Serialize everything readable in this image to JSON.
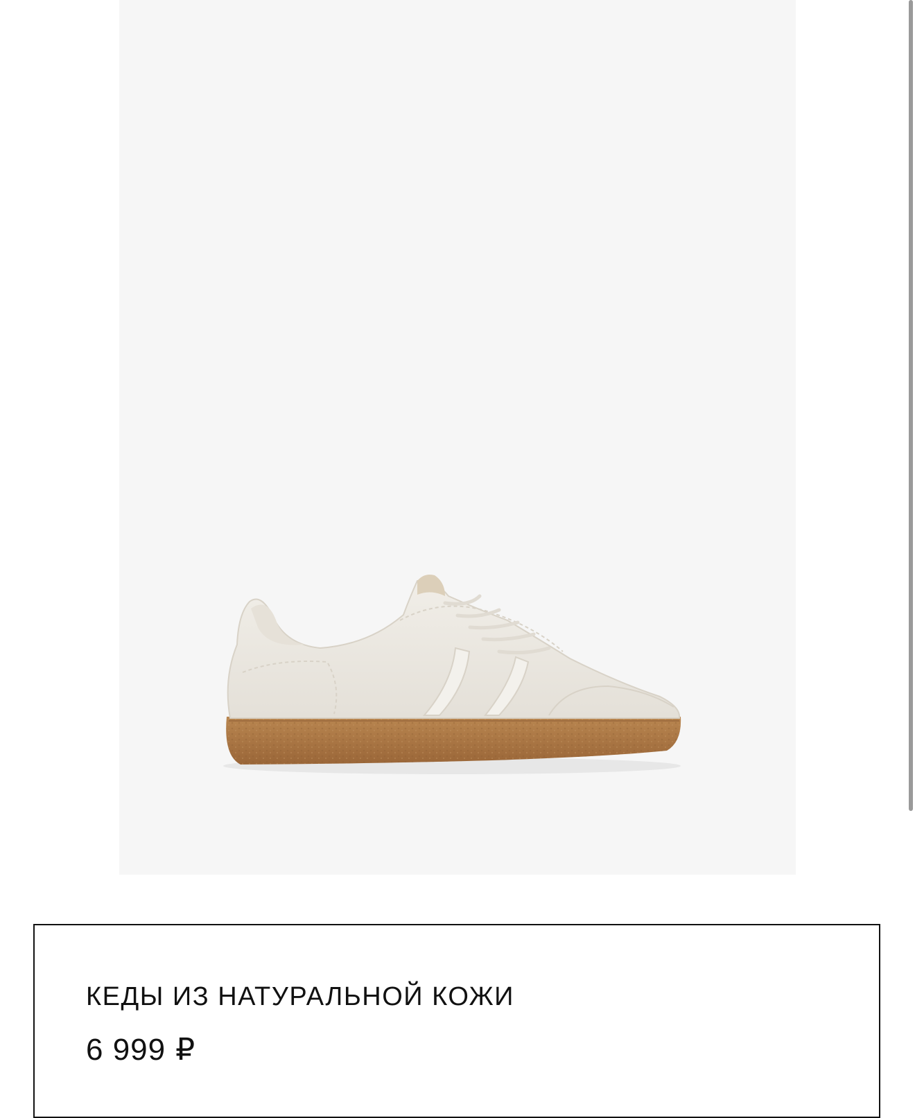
{
  "product": {
    "title": "КЕДЫ ИЗ НАТУРАЛЬНОЙ КОЖИ",
    "price": {
      "amount": "6 999",
      "currency": "₽"
    },
    "image": {
      "depicts": "sneaker-image",
      "colors": {
        "background": "#f6f6f6",
        "upper": "#ece9e2",
        "stitching": "#d8d2c7",
        "sole": "#b07a45",
        "sole_shadow": "#8d5e33"
      }
    }
  },
  "scrollbar": {
    "position_fraction": 0
  }
}
